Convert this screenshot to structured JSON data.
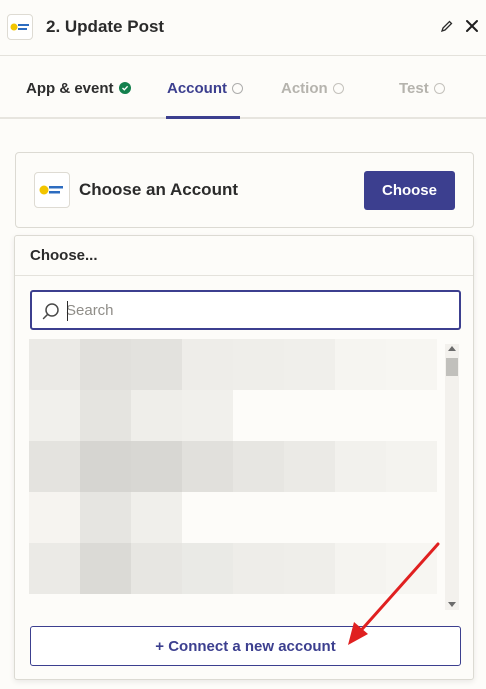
{
  "header": {
    "title": "2. Update Post",
    "logo_icon": "app-logo-icon",
    "edit_icon": "pencil-icon",
    "close_icon": "close-icon"
  },
  "tabs": [
    {
      "label": "App & event",
      "state": "done",
      "icon": "check-circle-icon"
    },
    {
      "label": "Account",
      "state": "active",
      "icon": "info-circle-icon"
    },
    {
      "label": "Action",
      "state": "disabled",
      "icon": "info-circle-icon"
    },
    {
      "label": "Test",
      "state": "disabled",
      "icon": "info-circle-icon"
    }
  ],
  "account": {
    "title": "Choose an Account",
    "choose_label": "Choose"
  },
  "dropdown": {
    "header": "Choose...",
    "search_placeholder": "Search",
    "search_value": "",
    "connect_label": "+ Connect a new account"
  },
  "colors": {
    "accent": "#3c3f8f",
    "success": "#13804d",
    "annotation_arrow": "#e02020"
  },
  "blurred_rows": [
    [
      "#ebeae6",
      "#e1e0dc",
      "#e3e2de",
      "#eeede9",
      "#efeeea",
      "#f0efeb",
      "#f6f5f1",
      "#f7f6f2"
    ],
    [
      "#f1f0ec",
      "#e5e4e0",
      "#efeeea",
      "#f1f0ec",
      "#fdfcf9",
      "#fdfcf9",
      "#fdfcf9",
      "#fdfcf9"
    ],
    [
      "#e4e3df",
      "#d6d5d1",
      "#d8d7d3",
      "#e1e0dc",
      "#e7e6e2",
      "#ebeae6",
      "#f2f1ed",
      "#f4f3ef"
    ],
    [
      "#f6f4f0",
      "#e6e5e1",
      "#f0efeb",
      "#fdfcf9",
      "#fdfcf9",
      "#fdfcf9",
      "#fdfcf9",
      "#fdfcf9"
    ],
    [
      "#ebeae6",
      "#dbdad6",
      "#e7e6e2",
      "#eaeae6",
      "#eeede9",
      "#efeeea",
      "#f5f4f0",
      "#f7f6f2"
    ]
  ]
}
